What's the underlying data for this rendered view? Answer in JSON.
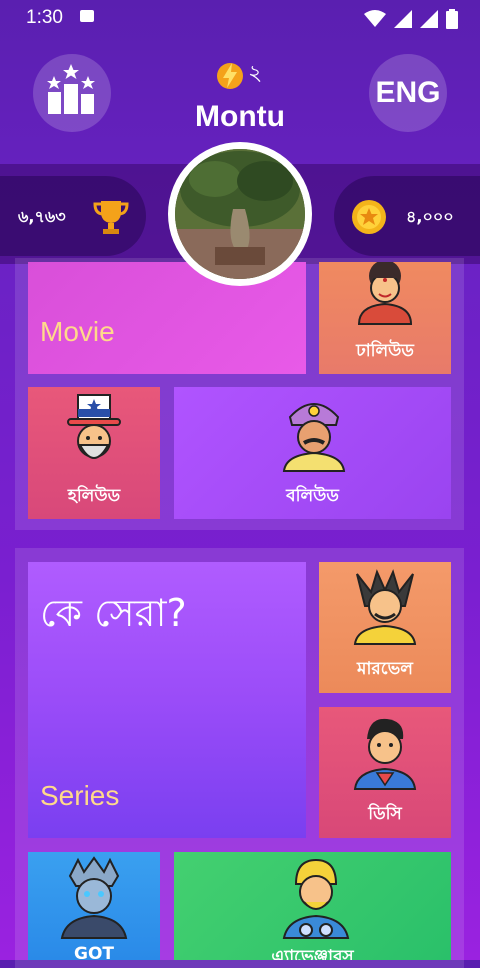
{
  "status": {
    "time": "1:30"
  },
  "header": {
    "energy_count": "২",
    "username": "Montu",
    "language_button": "ENG"
  },
  "stats": {
    "trophies": "৬,৭৬৩",
    "coins": "৪,০০০"
  },
  "tiles": {
    "movie": "Movie",
    "dhallywood": "ঢালিউড",
    "hollywood": "হলিউড",
    "bollywood": "বলিউড",
    "ke_sera": "কে সেরা?",
    "series": "Series",
    "marvel": "মারভেল",
    "dc": "ডিসি",
    "got": "GOT",
    "avengers": "এ্যাভেঞ্জারস"
  },
  "colors": {
    "accent_yellow": "#ffd98a",
    "background": "#6a22c4"
  }
}
